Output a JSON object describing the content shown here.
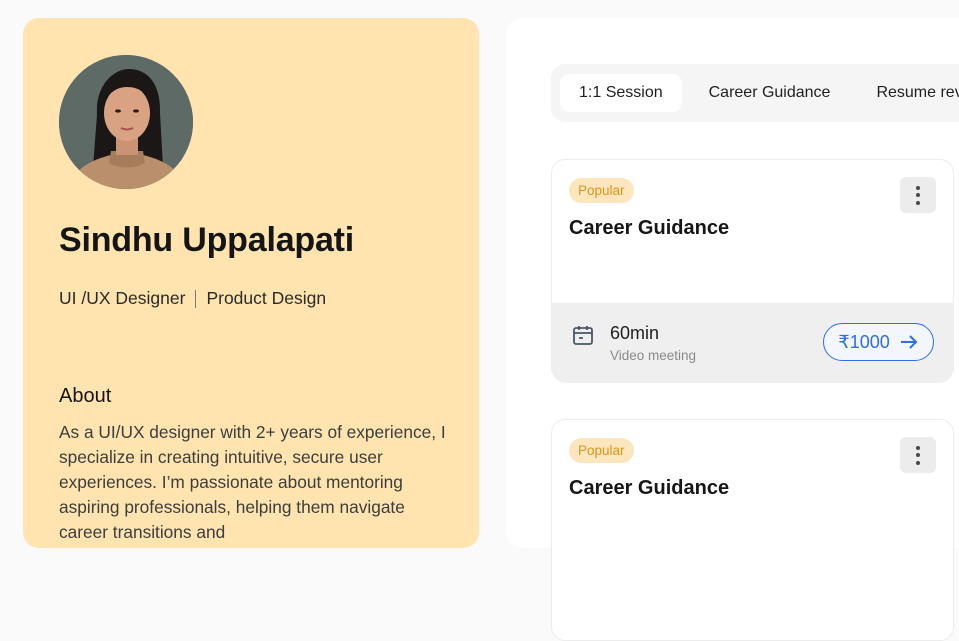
{
  "profile": {
    "name": "Sindhu Uppalapati",
    "role": "UI /UX Designer",
    "specialty": "Product Design",
    "about_title": "About",
    "about_text": "As a UI/UX designer with 2+ years of experience, I specialize in creating intuitive, secure user experiences. I’m passionate about mentoring aspiring professionals, helping them navigate career transitions and"
  },
  "tabs": [
    {
      "label": "1:1 Session",
      "active": true
    },
    {
      "label": "Career Guidance",
      "active": false
    },
    {
      "label": "Resume rev",
      "active": false
    }
  ],
  "services": [
    {
      "badge": "Popular",
      "title": "Career Guidance",
      "duration": "60min",
      "meeting_type": "Video meeting",
      "price": "₹1000",
      "icons": {
        "calendar": "calendar-icon",
        "more": "more-vertical-icon",
        "arrow": "arrow-right-icon"
      }
    },
    {
      "badge": "Popular",
      "title": "Career Guidance"
    }
  ],
  "colors": {
    "profile_bg": "#ffe4b0",
    "accent": "#2f6fe3",
    "badge_bg": "#fde6bd",
    "badge_text": "#d9961c"
  }
}
